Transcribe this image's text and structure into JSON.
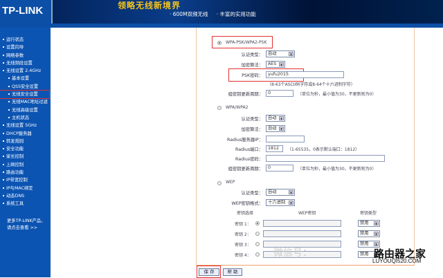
{
  "header": {
    "logo": "TP-LINK",
    "slogan": "领略无线新境界",
    "features": [
      "· 600M双频无线",
      "· 丰富的实用功能"
    ]
  },
  "sidebar": {
    "items": [
      {
        "label": "运行状态",
        "sub": false
      },
      {
        "label": "设置向导",
        "sub": false
      },
      {
        "label": "网络参数",
        "sub": false
      },
      {
        "label": "无线频段设置",
        "sub": false
      },
      {
        "label": "无线设置 2.4GHz",
        "sub": false
      },
      {
        "label": "基本设置",
        "sub": true
      },
      {
        "label": "QSS安全设置",
        "sub": true
      },
      {
        "label": "无线安全设置",
        "sub": true,
        "active": true
      },
      {
        "label": "无线MAC地址过滤",
        "sub": true
      },
      {
        "label": "无线高级设置",
        "sub": true
      },
      {
        "label": "主机状态",
        "sub": true
      },
      {
        "label": "无线设置 5GHz",
        "sub": false
      },
      {
        "label": "DHCP服务器",
        "sub": false
      },
      {
        "label": "转发规则",
        "sub": false
      },
      {
        "label": "安全功能",
        "sub": false
      },
      {
        "label": "家长控制",
        "sub": false
      },
      {
        "label": "上网控制",
        "sub": false
      },
      {
        "label": "路由功能",
        "sub": false
      },
      {
        "label": "IP带宽控制",
        "sub": false
      },
      {
        "label": "IP与MAC绑定",
        "sub": false
      },
      {
        "label": "动态DNS",
        "sub": false
      },
      {
        "label": "系统工具",
        "sub": false
      }
    ],
    "more": [
      "更多TP-LINK产品，",
      "请点击查看 >>"
    ]
  },
  "wpa_psk": {
    "title": "WPA-PSK/WPA2-PSK",
    "auth_label": "认证类型：",
    "auth": "自动",
    "enc_label": "加密算法：",
    "enc": "AES",
    "psk_label": "PSK密码：",
    "psk": "yufu2015",
    "psk_note": "（8-63个ASCII码字符或8-64个十六进制字符）",
    "renew_label": "组密钥更新周期：",
    "renew": "0",
    "renew_note": "（单位为秒，最小值为30，不更新则为0）"
  },
  "wpa": {
    "title": "WPA/WPA2",
    "auth_label": "认证类型：",
    "auth": "自动",
    "enc_label": "加密算法：",
    "enc": "自动",
    "ip_label": "Radius服务器IP：",
    "ip": "",
    "port_label": "Radius端口：",
    "port": "1812",
    "port_note": "（1-65535，0表示默认端口：1812）",
    "pwd_label": "Radius密码：",
    "pwd": "",
    "renew_label": "组密钥更新周期：",
    "renew": "0",
    "renew_note": "（单位为秒，最小值为30，不更新则为0）"
  },
  "wep": {
    "title": "WEP",
    "auth_label": "认证类型：",
    "auth": "自动",
    "fmt_label": "WEP密钥格式：",
    "fmt": "十六进制",
    "col_select": "密钥选择",
    "col_key": "WEP密钥",
    "col_type": "密钥类型",
    "keys": [
      {
        "label": "密钥 1：",
        "type": "禁用"
      },
      {
        "label": "密钥 2：",
        "type": "禁用"
      },
      {
        "label": "密钥 3：",
        "type": "禁用"
      },
      {
        "label": "密钥 4：",
        "type": "禁用"
      }
    ]
  },
  "buttons": {
    "save": "保 存",
    "help": "帮 助"
  },
  "watermark": {
    "wechat": "微信号：",
    "brand": "路由器之家",
    "url": "LUYOUQI520.COM"
  }
}
